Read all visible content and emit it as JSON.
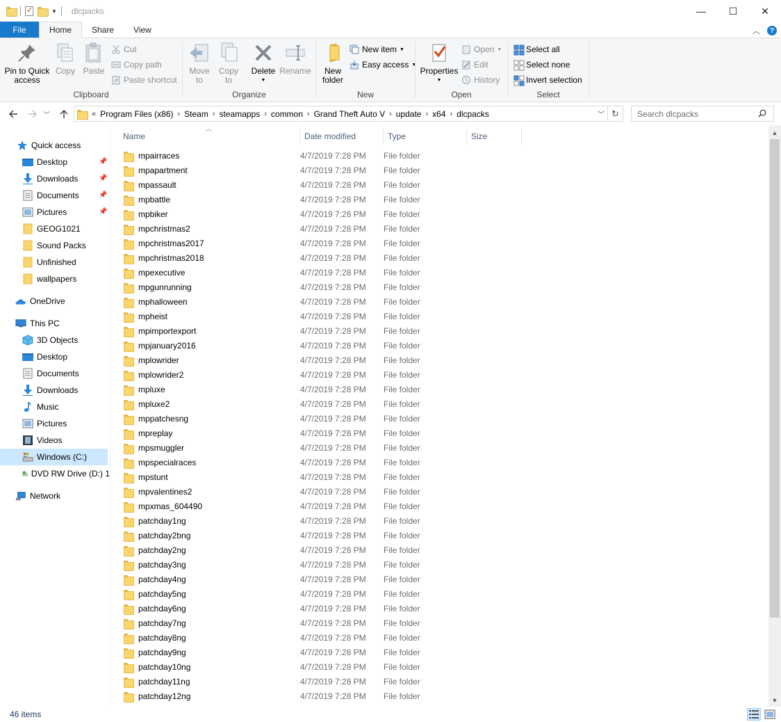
{
  "window": {
    "title": "dlcpacks",
    "minimize": "—",
    "maximize": "☐",
    "close": "✕"
  },
  "tabs": [
    {
      "label": "File"
    },
    {
      "label": "Home"
    },
    {
      "label": "Share"
    },
    {
      "label": "View"
    }
  ],
  "ribbon": {
    "clipboard": {
      "label": "Clipboard",
      "pin": "Pin to Quick access",
      "pin_line1": "Pin to Quick",
      "pin_line2": "access",
      "copy": "Copy",
      "paste": "Paste",
      "cut": "Cut",
      "copy_path": "Copy path",
      "paste_shortcut": "Paste shortcut"
    },
    "organize": {
      "label": "Organize",
      "move_line1": "Move",
      "move_line2": "to",
      "copy_line1": "Copy",
      "copy_line2": "to",
      "delete": "Delete",
      "rename": "Rename"
    },
    "new": {
      "label": "New",
      "new_folder_line1": "New",
      "new_folder_line2": "folder",
      "new_item": "New item",
      "easy_access": "Easy access"
    },
    "open": {
      "label": "Open",
      "properties": "Properties",
      "open": "Open",
      "edit": "Edit",
      "history": "History"
    },
    "select": {
      "label": "Select",
      "select_all": "Select all",
      "select_none": "Select none",
      "invert": "Invert selection"
    }
  },
  "address": {
    "overflow": "«",
    "crumbs": [
      "Program Files (x86)",
      "Steam",
      "steamapps",
      "common",
      "Grand Theft Auto V",
      "update",
      "x64",
      "dlcpacks"
    ],
    "search_placeholder": "Search dlcpacks"
  },
  "navpane": {
    "quick_access": "Quick access",
    "quick_items": [
      "Desktop",
      "Downloads",
      "Documents",
      "Pictures",
      "GEOG1021",
      "Sound Packs",
      "Unfinished",
      "wallpapers"
    ],
    "onedrive": "OneDrive",
    "this_pc": "This PC",
    "pc_items": [
      "3D Objects",
      "Desktop",
      "Documents",
      "Downloads",
      "Music",
      "Pictures",
      "Videos",
      "Windows (C:)",
      "DVD RW Drive (D:) 1"
    ],
    "network": "Network"
  },
  "columns": {
    "name": "Name",
    "date": "Date modified",
    "type": "Type",
    "size": "Size"
  },
  "files": [
    {
      "name": "mpairraces",
      "date": "4/7/2019 7:28 PM",
      "type": "File folder"
    },
    {
      "name": "mpapartment",
      "date": "4/7/2019 7:28 PM",
      "type": "File folder"
    },
    {
      "name": "mpassault",
      "date": "4/7/2019 7:28 PM",
      "type": "File folder"
    },
    {
      "name": "mpbattle",
      "date": "4/7/2019 7:28 PM",
      "type": "File folder"
    },
    {
      "name": "mpbiker",
      "date": "4/7/2019 7:28 PM",
      "type": "File folder"
    },
    {
      "name": "mpchristmas2",
      "date": "4/7/2019 7:28 PM",
      "type": "File folder"
    },
    {
      "name": "mpchristmas2017",
      "date": "4/7/2019 7:28 PM",
      "type": "File folder"
    },
    {
      "name": "mpchristmas2018",
      "date": "4/7/2019 7:28 PM",
      "type": "File folder"
    },
    {
      "name": "mpexecutive",
      "date": "4/7/2019 7:28 PM",
      "type": "File folder"
    },
    {
      "name": "mpgunrunning",
      "date": "4/7/2019 7:28 PM",
      "type": "File folder"
    },
    {
      "name": "mphalloween",
      "date": "4/7/2019 7:28 PM",
      "type": "File folder"
    },
    {
      "name": "mpheist",
      "date": "4/7/2019 7:28 PM",
      "type": "File folder"
    },
    {
      "name": "mpimportexport",
      "date": "4/7/2019 7:28 PM",
      "type": "File folder"
    },
    {
      "name": "mpjanuary2016",
      "date": "4/7/2019 7:28 PM",
      "type": "File folder"
    },
    {
      "name": "mplowrider",
      "date": "4/7/2019 7:28 PM",
      "type": "File folder"
    },
    {
      "name": "mplowrider2",
      "date": "4/7/2019 7:28 PM",
      "type": "File folder"
    },
    {
      "name": "mpluxe",
      "date": "4/7/2019 7:28 PM",
      "type": "File folder"
    },
    {
      "name": "mpluxe2",
      "date": "4/7/2019 7:28 PM",
      "type": "File folder"
    },
    {
      "name": "mppatchesng",
      "date": "4/7/2019 7:28 PM",
      "type": "File folder"
    },
    {
      "name": "mpreplay",
      "date": "4/7/2019 7:28 PM",
      "type": "File folder"
    },
    {
      "name": "mpsmuggler",
      "date": "4/7/2019 7:28 PM",
      "type": "File folder"
    },
    {
      "name": "mpspecialraces",
      "date": "4/7/2019 7:28 PM",
      "type": "File folder"
    },
    {
      "name": "mpstunt",
      "date": "4/7/2019 7:28 PM",
      "type": "File folder"
    },
    {
      "name": "mpvalentines2",
      "date": "4/7/2019 7:28 PM",
      "type": "File folder"
    },
    {
      "name": "mpxmas_604490",
      "date": "4/7/2019 7:28 PM",
      "type": "File folder"
    },
    {
      "name": "patchday1ng",
      "date": "4/7/2019 7:28 PM",
      "type": "File folder"
    },
    {
      "name": "patchday2bng",
      "date": "4/7/2019 7:28 PM",
      "type": "File folder"
    },
    {
      "name": "patchday2ng",
      "date": "4/7/2019 7:28 PM",
      "type": "File folder"
    },
    {
      "name": "patchday3ng",
      "date": "4/7/2019 7:28 PM",
      "type": "File folder"
    },
    {
      "name": "patchday4ng",
      "date": "4/7/2019 7:28 PM",
      "type": "File folder"
    },
    {
      "name": "patchday5ng",
      "date": "4/7/2019 7:28 PM",
      "type": "File folder"
    },
    {
      "name": "patchday6ng",
      "date": "4/7/2019 7:28 PM",
      "type": "File folder"
    },
    {
      "name": "patchday7ng",
      "date": "4/7/2019 7:28 PM",
      "type": "File folder"
    },
    {
      "name": "patchday8ng",
      "date": "4/7/2019 7:28 PM",
      "type": "File folder"
    },
    {
      "name": "patchday9ng",
      "date": "4/7/2019 7:28 PM",
      "type": "File folder"
    },
    {
      "name": "patchday10ng",
      "date": "4/7/2019 7:28 PM",
      "type": "File folder"
    },
    {
      "name": "patchday11ng",
      "date": "4/7/2019 7:28 PM",
      "type": "File folder"
    },
    {
      "name": "patchday12ng",
      "date": "4/7/2019 7:28 PM",
      "type": "File folder"
    }
  ],
  "status": {
    "count": "46 items"
  },
  "colors": {
    "accent": "#1979ca",
    "selection": "#cce8ff",
    "folder": "#fbd66e"
  },
  "icons": {
    "file_row": "folder-icon",
    "nav_back": "arrow-left-icon",
    "nav_forward": "arrow-right-icon",
    "nav_up": "arrow-up-icon"
  }
}
